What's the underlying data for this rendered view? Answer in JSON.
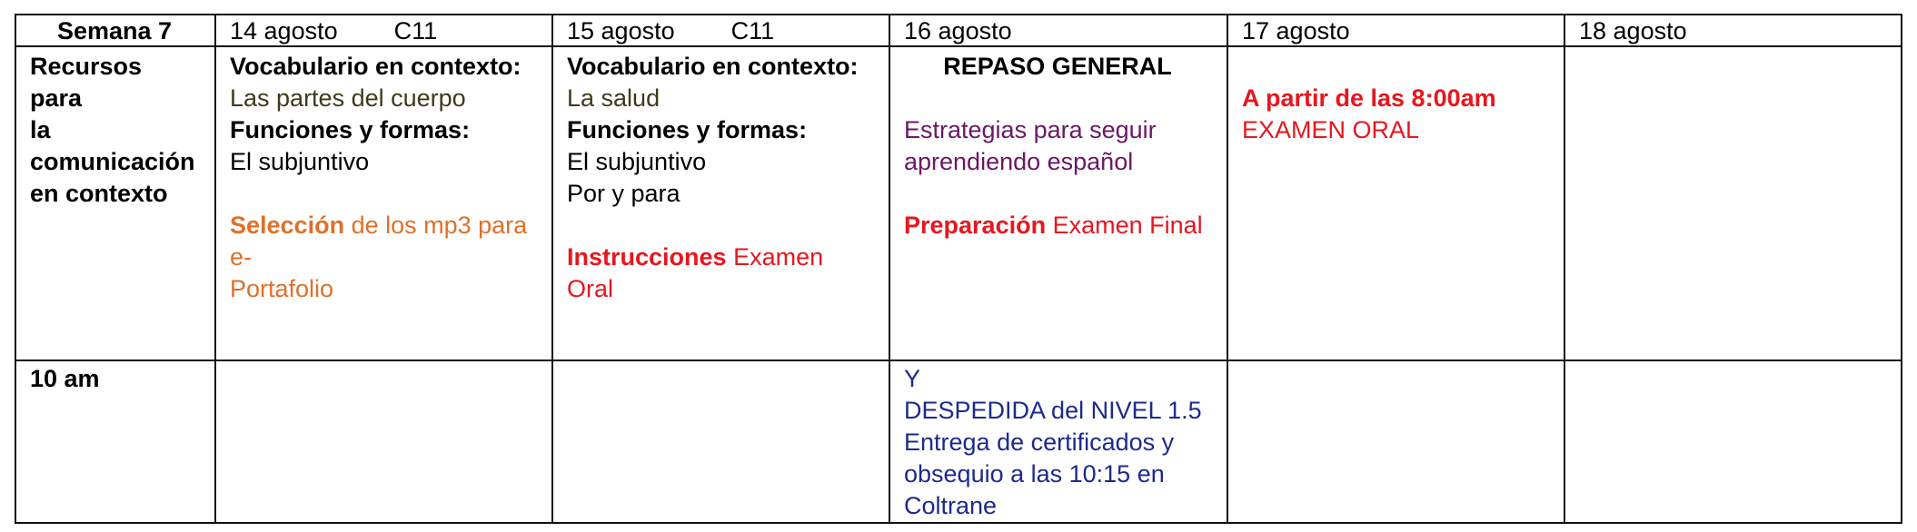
{
  "header": {
    "week": "Semana 7",
    "days": [
      {
        "date": "14 agosto",
        "code": "C11"
      },
      {
        "date": "15 agosto",
        "code": "C11"
      },
      {
        "date": "16 agosto",
        "code": ""
      },
      {
        "date": "17 agosto",
        "code": ""
      },
      {
        "date": "18 agosto",
        "code": ""
      }
    ]
  },
  "content_row": {
    "label": [
      "Recursos para",
      "la",
      "comunicación",
      "en contexto"
    ],
    "day14": {
      "vocab_heading": "Vocabulario en contexto:",
      "vocab_topic": "Las partes del cuerpo",
      "functions_heading": "Funciones y formas:",
      "functions_items": [
        "El subjuntivo"
      ],
      "note_bold": "Selección",
      "note_text_line1": " de los mp3 para e-",
      "note_text_line2": "Portafolio"
    },
    "day15": {
      "vocab_heading": "Vocabulario en contexto:",
      "vocab_topic": "La salud",
      "functions_heading": "Funciones y formas:",
      "functions_items": [
        "El subjuntivo",
        "Por y para"
      ],
      "note_bold": "Instrucciones",
      "note_text": " Examen Oral"
    },
    "day16": {
      "title": "REPASO GENERAL",
      "strategies": [
        "Estrategias para seguir",
        "aprendiendo español"
      ],
      "prep_bold": "Preparación",
      "prep_text": " Examen Final"
    },
    "day17": {
      "time": "A partir de las 8:00am",
      "exam": "EXAMEN ORAL"
    },
    "day18": {}
  },
  "time_row": {
    "label": "10 am",
    "day16": [
      "Y",
      "DESPEDIDA del NIVEL 1.5",
      "Entrega de certificados y",
      "obsequio a las 10:15 en",
      "Coltrane"
    ]
  }
}
